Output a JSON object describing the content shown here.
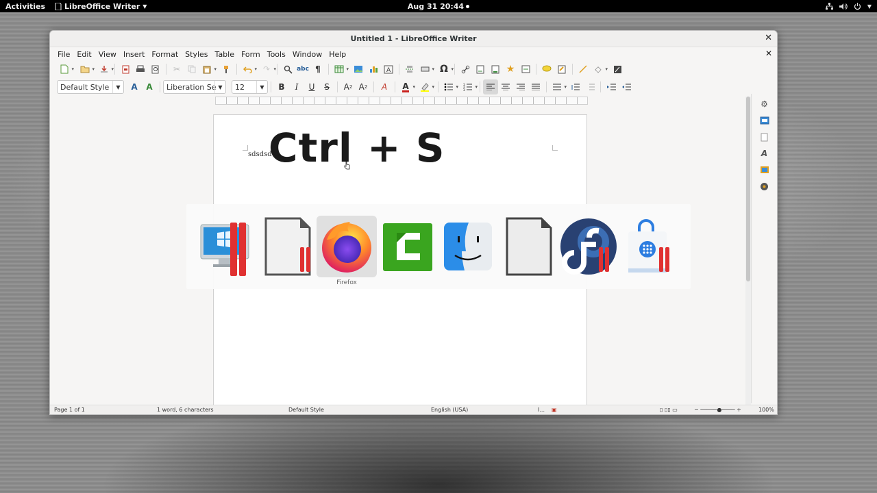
{
  "topbar": {
    "activities": "Activities",
    "app_menu": "LibreOffice Writer",
    "clock": "Aug 31  20:44"
  },
  "window": {
    "title": "Untitled 1 - LibreOffice Writer"
  },
  "menu": [
    "File",
    "Edit",
    "View",
    "Insert",
    "Format",
    "Styles",
    "Table",
    "Form",
    "Tools",
    "Window",
    "Help"
  ],
  "formatting": {
    "paragraph_style": "Default Style",
    "font_name": "Liberation Se",
    "font_size": "12"
  },
  "document": {
    "small_text": "sdsdsd",
    "overlay_text": "Ctrl + S"
  },
  "switcher": {
    "selected_label": "Firefox",
    "apps": [
      "windows-vm",
      "libreoffice-draw",
      "firefox",
      "camtasia",
      "finder",
      "libreoffice",
      "fedora",
      "software-store"
    ]
  },
  "statusbar": {
    "page": "Page 1 of 1",
    "words": "1 word, 6 characters",
    "style": "Default Style",
    "language": "English (USA)",
    "zoom": "100%"
  },
  "colors": {
    "accent_red": "#e03131",
    "firefox_orange": "#ff9500",
    "fedora_blue": "#294172"
  }
}
